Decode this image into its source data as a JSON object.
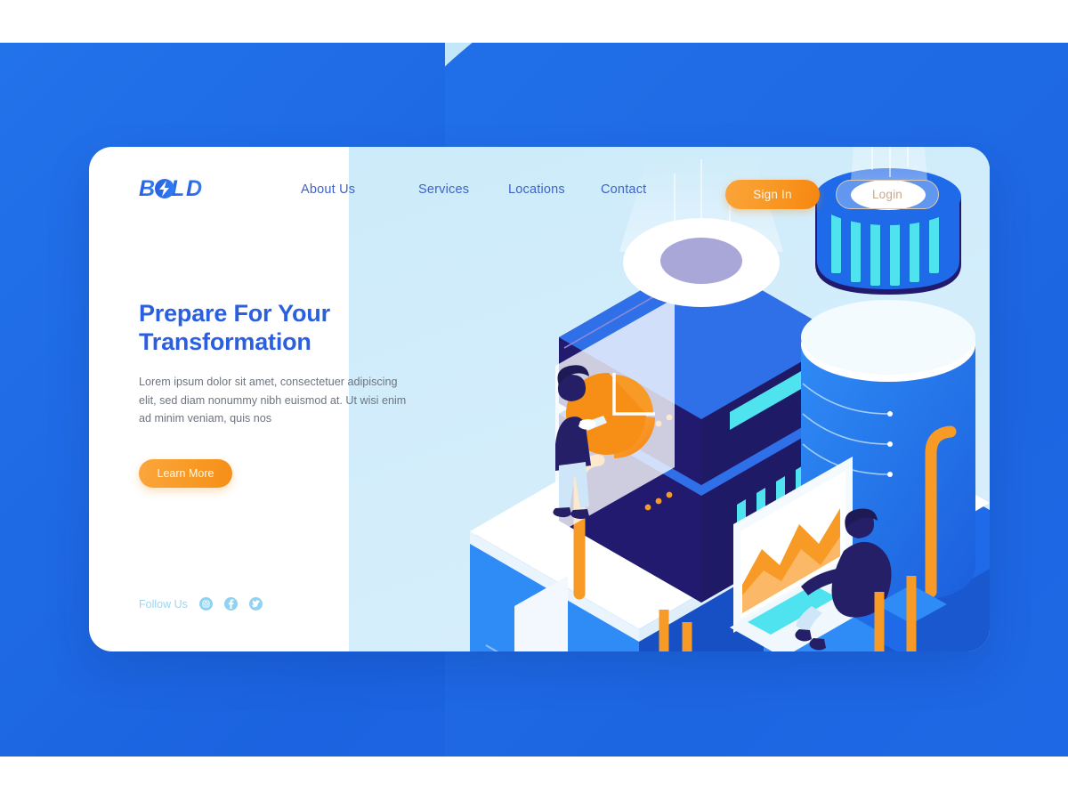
{
  "brand": {
    "name": "BOLD",
    "logo_icon": "bolt-icon",
    "color": "#2a5fe0"
  },
  "nav": {
    "items": [
      {
        "label": "About Us"
      },
      {
        "label": "Services"
      },
      {
        "label": "Locations"
      },
      {
        "label": "Contact"
      }
    ]
  },
  "auth": {
    "signin_label": "Sign In",
    "login_label": "Login",
    "signin_color": "#f89a27",
    "login_border_color": "#ddc9b4"
  },
  "hero": {
    "title_line1": "Prepare For Your",
    "title_line2": "Transformation",
    "body": "Lorem ipsum dolor sit amet, consectetuer adipiscing elit, sed diam nonummy nibh euismod at. Ut wisi enim ad minim veniam, quis nos",
    "cta_label": "Learn More",
    "cta_color": "#f79a26",
    "title_color": "#2a5fe0"
  },
  "follow": {
    "label": "Follow Us",
    "icon_color": "#8fd2f2",
    "socials": [
      {
        "name": "instagram-icon"
      },
      {
        "name": "facebook-icon"
      },
      {
        "name": "twitter-icon"
      }
    ]
  },
  "illustration": {
    "name": "isometric-data-center-illustration",
    "elements": [
      "server-cube",
      "database-cylinder",
      "pie-chart",
      "area-chart-laptop",
      "person-with-tablet",
      "person-at-laptop",
      "orange-cables",
      "light-beams"
    ],
    "palette": {
      "deep_navy": "#221a6e",
      "blue": "#1f6ae8",
      "bright_blue": "#2f8bf5",
      "cyan": "#4fe3f0",
      "orange": "#f79a26",
      "white": "#ffffff"
    }
  },
  "background": {
    "blue": "#1f6ae8",
    "light_blue": "#c3e6f8",
    "card": "#ffffff"
  }
}
